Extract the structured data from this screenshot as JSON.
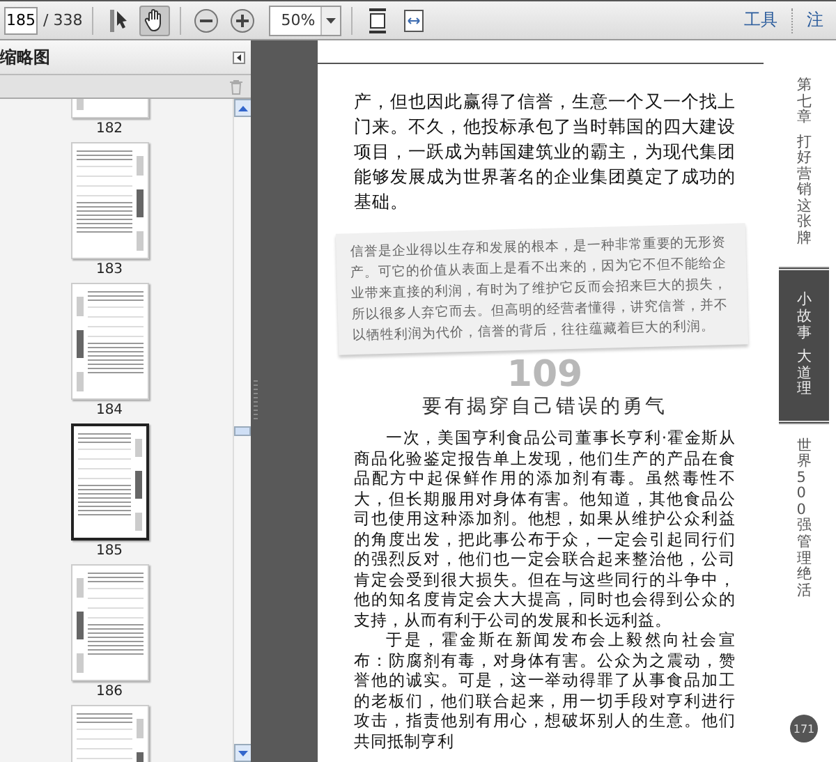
{
  "toolbar": {
    "page_number": "185",
    "page_count": "/ 338",
    "zoom": "50%",
    "tools_label": "工具",
    "comment_label": "注"
  },
  "sidebar": {
    "title": "缩略图",
    "thumbnails": [
      {
        "label": "182",
        "selected": false
      },
      {
        "label": "183",
        "selected": false
      },
      {
        "label": "184",
        "selected": false
      },
      {
        "label": "185",
        "selected": true
      },
      {
        "label": "186",
        "selected": false
      },
      {
        "selected": false
      }
    ]
  },
  "document": {
    "intro": "产，但也因此赢得了信誉，生意一个又一个找上门来。不久，他投标承包了当时韩国的四大建设项目，一跃成为韩国建筑业的霸主，为现代集团能够发展成为世界著名的企业集团奠定了成功的基础。",
    "quote": "信誉是企业得以生存和发展的根本，是一种非常重要的无形资产。可它的价值从表面上是看不出来的，因为它不但不能给企业带来直接的利润，有时为了维护它反而会招来巨大的损失，所以很多人弃它而去。但高明的经营者懂得，讲究信誉，并不以牺牲利润为代价，信誉的背后，往往蕴藏着巨大的利润。",
    "section_number": "109",
    "section_title": "要有揭穿自己错误的勇气",
    "paragraphs": [
      "一次，美国亨利食品公司董事长亨利·霍金斯从商品化验鉴定报告单上发现，他们生产的产品在食品配方中起保鲜作用的添加剂有毒。虽然毒性不大，但长期服用对身体有害。他知道，其他食品公司也使用这种添加剂。他想，如果从维护公众利益的角度出发，把此事公布于众，一定会引起同行们的强烈反对，他们也一定会联合起来整治他，公司肯定会受到很大损失。但在与这些同行的斗争中，他的知名度肯定会大大提高，同时也会得到公众的支持，从而有利于公司的发展和长远利益。",
      "于是，霍金斯在新闻发布会上毅然向社会宣布：防腐剂有毒，对身体有害。公众为之震动，赞誉他的诚实。可是，这一举动得罪了从事食品加工的老板们，他们联合起来，用一切手段对亨利进行攻击，指责他别有用心，想破坏别人的生意。他们共同抵制亨利"
    ],
    "side_tabs": [
      {
        "texts": [
          "第七章",
          "打好营销这张牌"
        ],
        "highlighted": false
      },
      {
        "texts": [
          "小故事",
          "大道理"
        ],
        "highlighted": true
      },
      {
        "texts": [
          "世界500强管理绝活"
        ],
        "highlighted": false
      }
    ],
    "page_number": "171"
  }
}
